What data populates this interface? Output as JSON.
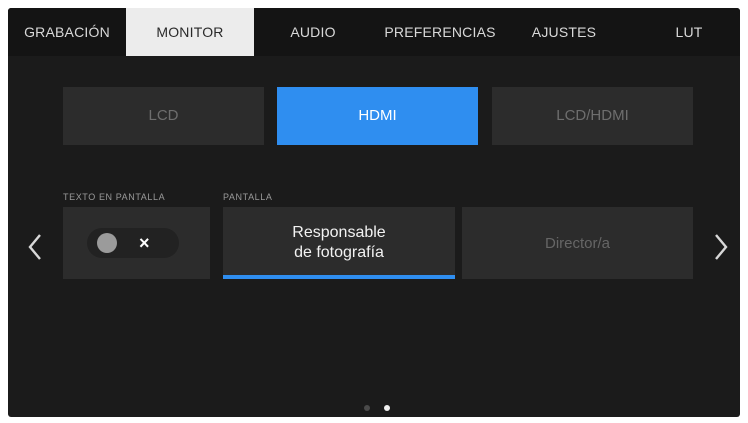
{
  "tabs": [
    "GRABACIÓN",
    "MONITOR",
    "AUDIO",
    "PREFERENCIAS",
    "AJUSTES",
    "LUT"
  ],
  "active_tab": "MONITOR",
  "output": {
    "options": [
      "LCD",
      "HDMI",
      "LCD/HDMI"
    ],
    "selected": "HDMI"
  },
  "screen_text": {
    "label": "TEXTO EN PANTALLA",
    "toggle_symbol": "×",
    "enabled": false
  },
  "display": {
    "label": "PANTALLA",
    "options": [
      {
        "line1": "Responsable",
        "line2": "de fotografía"
      },
      {
        "line1": "Director/a",
        "line2": ""
      }
    ],
    "selected": "Responsable de fotografía"
  },
  "pagination": {
    "current": 2,
    "total": 2
  },
  "colors": {
    "accent": "#2f8ef0",
    "background": "#1b1b1b",
    "button": "#2c2c2c",
    "tab_active_bg": "#ececec"
  },
  "icons": {
    "prev": "chevron-left-icon",
    "next": "chevron-right-icon"
  }
}
